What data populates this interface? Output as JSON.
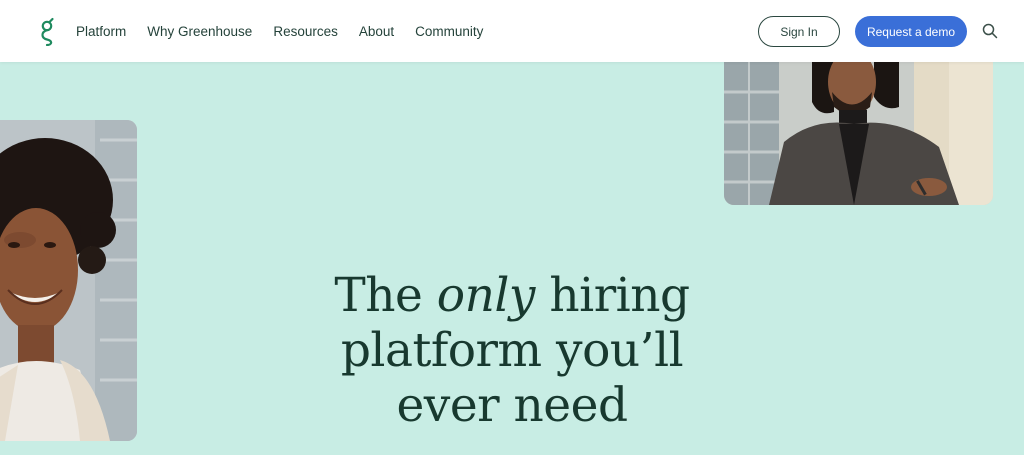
{
  "header": {
    "logo_icon": "greenhouse-g-logo",
    "nav": [
      {
        "label": "Platform"
      },
      {
        "label": "Why Greenhouse"
      },
      {
        "label": "Resources"
      },
      {
        "label": "About"
      },
      {
        "label": "Community"
      }
    ],
    "signin_label": "Sign In",
    "demo_label": "Request a demo",
    "search_icon": "search-icon"
  },
  "hero": {
    "headline_part1": "The",
    "headline_em": "only",
    "headline_part2": "hiring",
    "headline_line2": "platform you’ll",
    "headline_line3": "ever need",
    "left_photo": "smiling-woman-photo",
    "right_photo": "man-at-desk-photo"
  },
  "colors": {
    "hero_bg": "#c8ede4",
    "brand_green": "#1f8a5f",
    "text_dark": "#18392f",
    "demo_button": "#3a6fd8"
  }
}
